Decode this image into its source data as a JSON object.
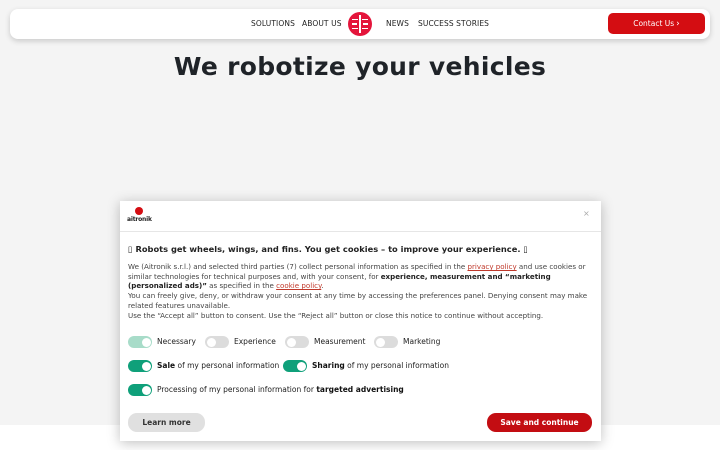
{
  "nav": {
    "solutions": "SOLUTIONS",
    "about": "ABOUT US",
    "news": "NEWS",
    "success": "SUCCESS STORIES",
    "contact": "Contact Us",
    "contact_icon": "chevron-right-icon"
  },
  "hero": {
    "title": "We robotize your vehicles"
  },
  "consent": {
    "brand": "aitronik",
    "close": "×",
    "title": "▯ Robots get wheels, wings, and fins. You get cookies – to improve your experience. ▯",
    "body": {
      "p1_a": "We (Aitronik s.r.l.) and selected third parties (7) collect personal information as specified in the ",
      "privacy_link": "privacy policy",
      "p1_b": " and use cookies or similar technologies for technical purposes and, with your consent, for ",
      "p1_bold": "experience, measurement and “marketing (personalized ads)”",
      "p1_c": " as specified in the ",
      "cookie_link": "cookie policy",
      "p1_d": ".",
      "p2": "You can freely give, deny, or withdraw your consent at any time by accessing the preferences panel. Denying consent may make related features unavailable.",
      "p3": "Use the “Accept all” button to consent. Use the “Reject all” button or close this notice to continue without accepting."
    },
    "toggles": {
      "necessary": {
        "label": "Necessary",
        "state": "on-disabled"
      },
      "experience": {
        "label": "Experience",
        "state": "off"
      },
      "measurement": {
        "label": "Measurement",
        "state": "off"
      },
      "marketing": {
        "label": "Marketing",
        "state": "off"
      },
      "sale": {
        "bold": "Sale",
        "rest": " of my personal information",
        "state": "on"
      },
      "sharing": {
        "bold": "Sharing",
        "rest": " of my personal information",
        "state": "on"
      },
      "targeted": {
        "rest": "Processing of my personal information for ",
        "bold": "targeted advertising",
        "state": "on"
      }
    },
    "learn_more": "Learn more",
    "save": "Save and continue"
  },
  "colors": {
    "brand_red": "#d40d12",
    "toggle_on": "#0fa07a",
    "toggle_off": "#dcdcdc",
    "page_bg": "#f4f4f4"
  }
}
